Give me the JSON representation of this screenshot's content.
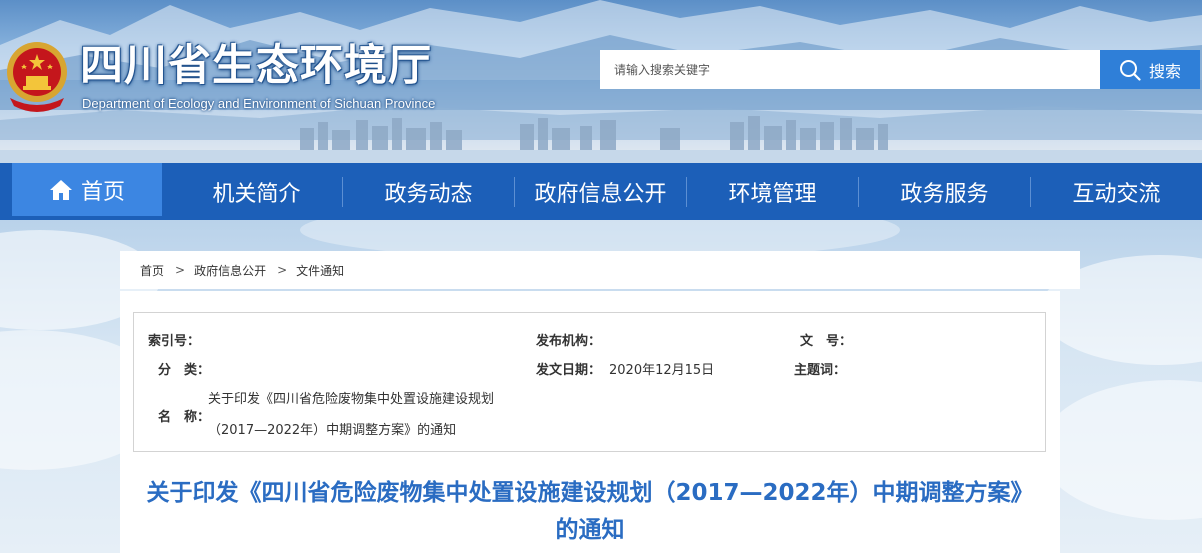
{
  "header": {
    "site_title": "四川省生态环境厅",
    "site_subtitle": "Department of Ecology and Environment of Sichuan Province",
    "emblem_icon": "national-emblem-icon"
  },
  "search": {
    "placeholder": "请输入搜索关键字",
    "button_label": "搜索",
    "icon": "search-icon"
  },
  "nav": {
    "items": [
      {
        "label": "首页",
        "icon": "home-icon"
      },
      {
        "label": "机关简介"
      },
      {
        "label": "政务动态"
      },
      {
        "label": "政府信息公开"
      },
      {
        "label": "环境管理"
      },
      {
        "label": "政务服务"
      },
      {
        "label": "互动交流"
      }
    ]
  },
  "breadcrumb": {
    "items": [
      "首页",
      "政府信息公开",
      "文件通知"
    ],
    "separator": ">"
  },
  "meta": {
    "index_label": "索引号：",
    "index_value": "",
    "publisher_label": "发布机构：",
    "publisher_value": "",
    "doc_no_label": "文　号：",
    "doc_no_value": "",
    "category_label": "分　类：",
    "category_value": "",
    "date_label": "发文日期：",
    "date_value": "2020年12月15日",
    "subject_label": "主题词：",
    "subject_value": "",
    "name_label": "名　称：",
    "name_line1": "关于印发《四川省危险废物集中处置设施建设规划",
    "name_line2": "（2017—2022年）中期调整方案》的通知"
  },
  "document": {
    "title_line1": "关于印发《四川省危险废物集中处置设施建设规划（2017—2022年）中期调整方案》",
    "title_line2": "的通知"
  },
  "colors": {
    "nav_bg": "#1c5fb8",
    "nav_active": "#3c86e2",
    "search_button": "#2f7fd8",
    "title_blue": "#2a6cc2"
  }
}
